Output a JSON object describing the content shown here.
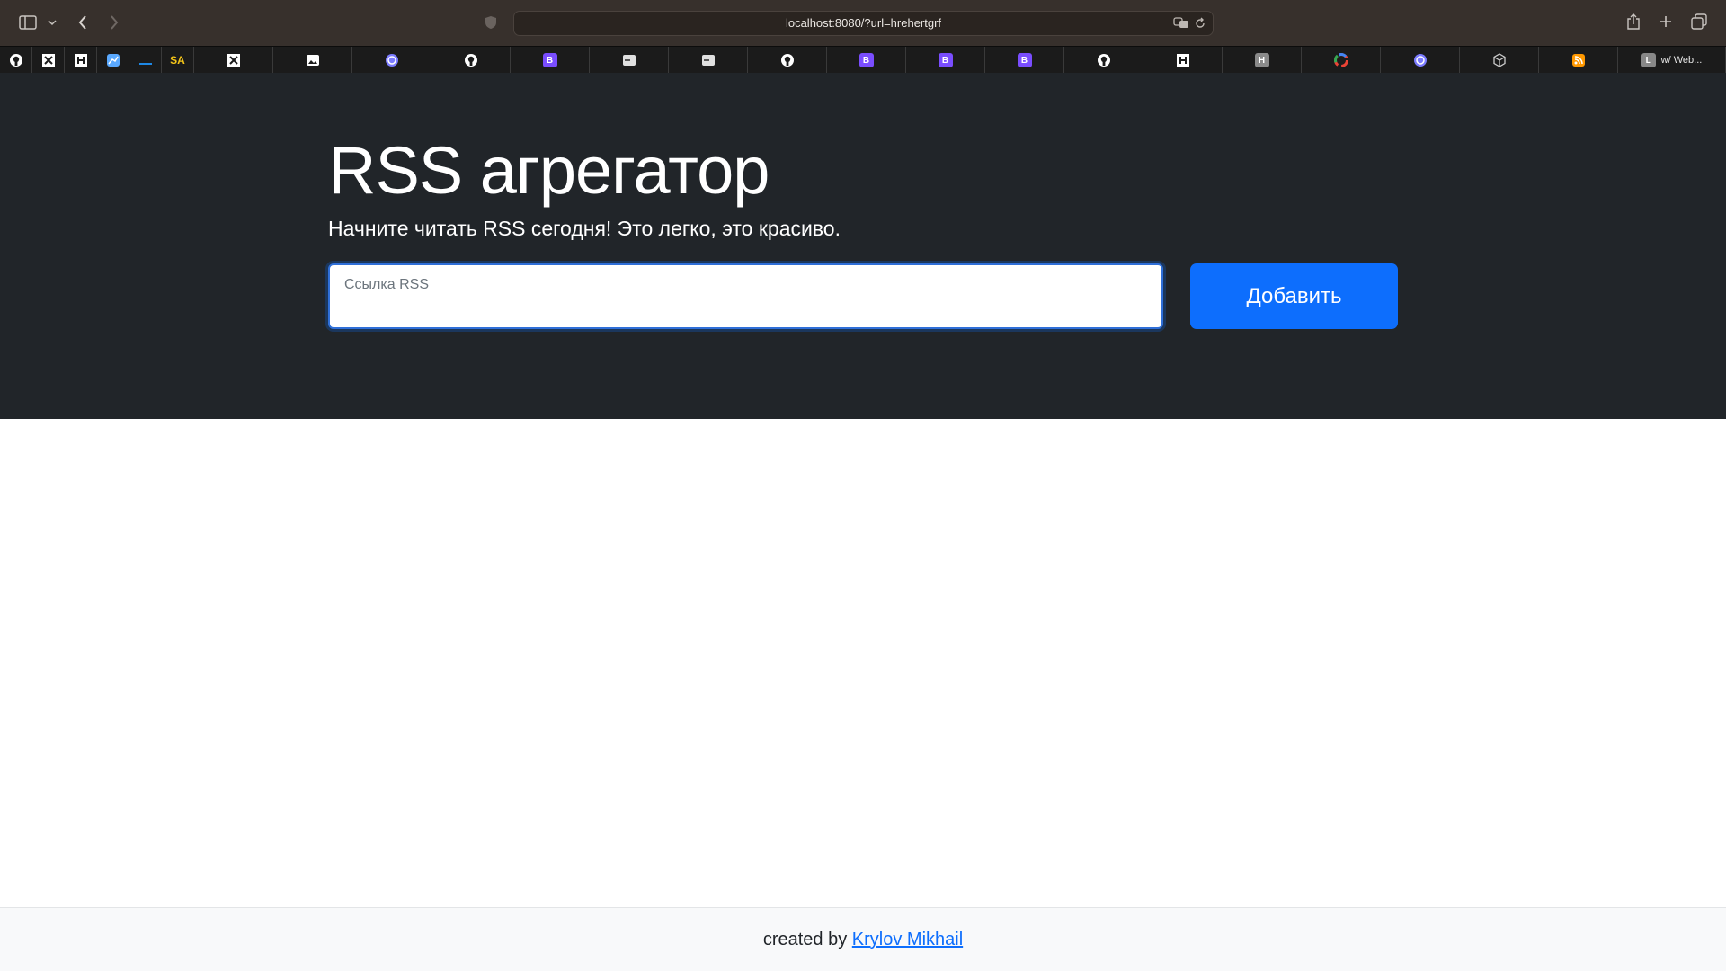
{
  "browser": {
    "url": "localhost:8080/?url=hrehertgrf",
    "tabs": [
      {
        "icon": "github-icon",
        "color": "#ffffff"
      },
      {
        "icon": "x-icon",
        "color": "#ffffff"
      },
      {
        "icon": "h-icon",
        "color": "#ffffff"
      },
      {
        "icon": "chart-icon",
        "color": "#5aa9ff"
      },
      {
        "icon": "dash-icon",
        "color": "#1e88e5"
      },
      {
        "icon": "sa-icon",
        "color": "#f5c518"
      },
      {
        "icon": "x-icon",
        "color": "#ffffff"
      },
      {
        "icon": "picture-icon",
        "color": "#ffffff"
      },
      {
        "icon": "circle-icon",
        "color": "#7b7bff"
      },
      {
        "icon": "github-icon",
        "color": "#ffffff"
      },
      {
        "icon": "b-icon",
        "color": "#7a4dff"
      },
      {
        "icon": "card-icon",
        "color": "#e0e0e0"
      },
      {
        "icon": "card-icon",
        "color": "#e0e0e0"
      },
      {
        "icon": "github-icon",
        "color": "#ffffff"
      },
      {
        "icon": "b-icon",
        "color": "#7a4dff"
      },
      {
        "icon": "b-icon",
        "color": "#7a4dff"
      },
      {
        "icon": "b-icon",
        "color": "#7a4dff"
      },
      {
        "icon": "github-icon",
        "color": "#ffffff"
      },
      {
        "icon": "h-icon",
        "color": "#ffffff"
      },
      {
        "icon": "h-gray-icon",
        "color": "#8a8a8a"
      },
      {
        "icon": "google-icon",
        "color": "#ea4335"
      },
      {
        "icon": "circle-icon",
        "color": "#7b7bff"
      },
      {
        "icon": "cube-icon",
        "color": "#cccccc"
      },
      {
        "icon": "rss-icon",
        "color": "#ff9800"
      },
      {
        "icon": "l-icon",
        "color": "#888888",
        "label": "w/ Web..."
      }
    ]
  },
  "hero": {
    "title": "RSS агрегатор",
    "lead": "Начните читать RSS сегодня! Это легко, это красиво.",
    "input_placeholder": "Ссылка RSS",
    "add_button": "Добавить"
  },
  "footer": {
    "prefix": "created by",
    "author": "Krylov Mikhail"
  },
  "colors": {
    "hero_bg": "#212529",
    "primary": "#0d6efd",
    "footer_bg": "#f8f9fa"
  }
}
